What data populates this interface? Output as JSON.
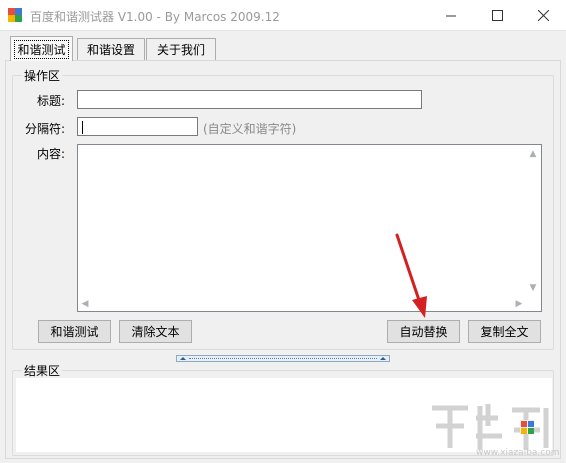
{
  "window": {
    "title": "百度和谐测试器 V1.00 - By Marcos 2009.12",
    "icon_colors": [
      "#e74c3c",
      "#3a7bd5",
      "#f5b400",
      "#2ea24a"
    ]
  },
  "tabs": [
    {
      "label": "和谐测试",
      "active": true
    },
    {
      "label": "和谐设置",
      "active": false
    },
    {
      "label": "关于我们",
      "active": false
    }
  ],
  "operation": {
    "group_title": "操作区",
    "title_label": "标题:",
    "title_value": "",
    "separator_label": "分隔符:",
    "separator_value": "",
    "separator_hint": "(自定义和谐字符)",
    "content_label": "内容:",
    "content_value": ""
  },
  "buttons": {
    "test": "和谐测试",
    "clear": "清除文本",
    "auto_replace": "自动替换",
    "copy_all": "复制全文"
  },
  "result": {
    "group_title": "结果区"
  },
  "watermark": {
    "text": "www.xiazaiba.com"
  },
  "annotation": {
    "arrow_color": "#d42020"
  }
}
